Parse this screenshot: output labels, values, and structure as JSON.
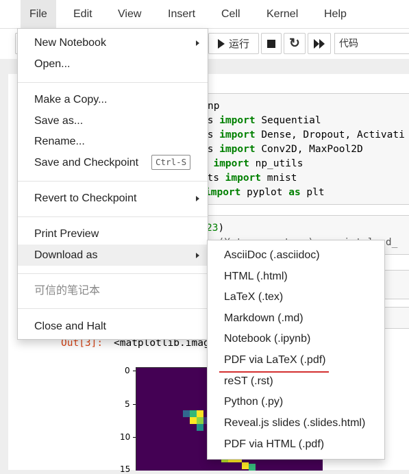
{
  "menubar": {
    "items": [
      {
        "label": "File"
      },
      {
        "label": "Edit"
      },
      {
        "label": "View"
      },
      {
        "label": "Insert"
      },
      {
        "label": "Cell"
      },
      {
        "label": "Kernel"
      },
      {
        "label": "Help"
      }
    ]
  },
  "toolbar": {
    "run_label": "运行",
    "cell_type": "代码"
  },
  "code": {
    "lines": [
      {
        "pre": "np",
        "kw": "",
        "post": ""
      },
      {
        "pre": "ls ",
        "kw": "import",
        "post": " Sequential"
      },
      {
        "pre": "rs ",
        "kw": "import",
        "post": " Dense, Dropout, Activati"
      },
      {
        "pre": "rs ",
        "kw": "import",
        "post": " Conv2D, MaxPool2D"
      },
      {
        "pre": "s ",
        "kw": "import",
        "post": " np_utils"
      },
      {
        "pre": "sets ",
        "kw": "import",
        "post": " mnist"
      },
      {
        "pre": " ",
        "kw": "import",
        "post": " pyplot ",
        "kw2": "as",
        "post2": " plt"
      }
    ],
    "cell2_line1_num": "23",
    "cell2_line1_close": ")",
    "cell2_line2": "= (X_t..., y_t...) = mnist.load_"
  },
  "output": {
    "prompt": "Out[3]:",
    "text": "<matplotlib.imag"
  },
  "plot": {
    "yticks": [
      "0",
      "5",
      "10",
      "15"
    ]
  },
  "file_menu": {
    "new_notebook": "New Notebook",
    "open": "Open...",
    "make_copy": "Make a Copy...",
    "save_as": "Save as...",
    "rename": "Rename...",
    "save_checkpoint": "Save and Checkpoint",
    "save_shortcut": "Ctrl-S",
    "revert": "Revert to Checkpoint",
    "print_preview": "Print Preview",
    "download_as": "Download as",
    "trusted": "可信的笔记本",
    "close_halt": "Close and Halt"
  },
  "download_menu": {
    "items": [
      "AsciiDoc (.asciidoc)",
      "HTML (.html)",
      "LaTeX (.tex)",
      "Markdown (.md)",
      "Notebook (.ipynb)",
      "PDF via LaTeX (.pdf)",
      "reST (.rst)",
      "Python (.py)",
      "Reveal.js slides (.slides.html)",
      "PDF via HTML (.pdf)"
    ]
  },
  "colors": {
    "keyword": "#008000",
    "out_prompt": "#d84315",
    "underline": "#d32f2f",
    "plot_bg": "#440154"
  }
}
